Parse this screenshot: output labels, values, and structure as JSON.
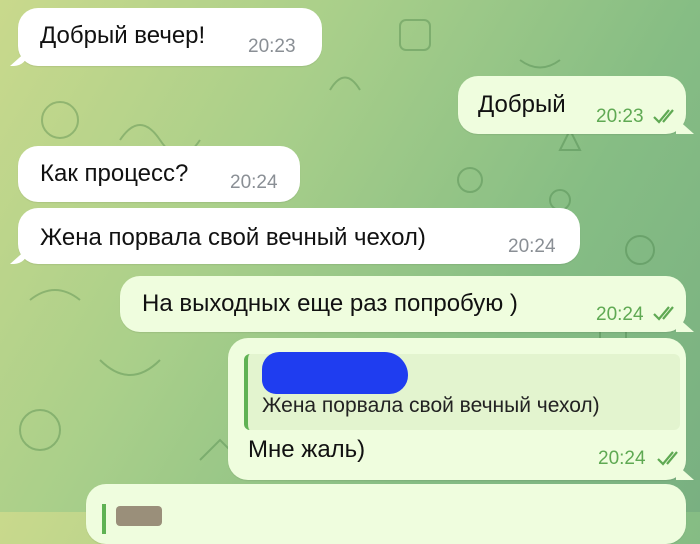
{
  "messages": [
    {
      "text": "Добрый вечер!",
      "time": "20:23",
      "direction": "incoming"
    },
    {
      "text": "Добрый",
      "time": "20:23",
      "direction": "outgoing",
      "status": "read"
    },
    {
      "text": "Как процесс?",
      "time": "20:24",
      "direction": "incoming"
    },
    {
      "text": "Жена порвала свой вечный чехол)",
      "time": "20:24",
      "direction": "incoming"
    },
    {
      "text": "На выходных еще раз попробую )",
      "time": "20:24",
      "direction": "outgoing",
      "status": "read"
    },
    {
      "text": "Мне жаль)",
      "time": "20:24",
      "direction": "outgoing",
      "status": "read",
      "reply_to": {
        "author": "",
        "text": "Жена порвала свой вечный чехол)"
      }
    }
  ],
  "colors": {
    "incoming_bubble": "#ffffff",
    "outgoing_bubble": "#effdde",
    "outgoing_time": "#5fa953",
    "quote_bar": "#5fb253",
    "redaction": "#1f3df0"
  },
  "icons": [
    "double-check-icon"
  ]
}
